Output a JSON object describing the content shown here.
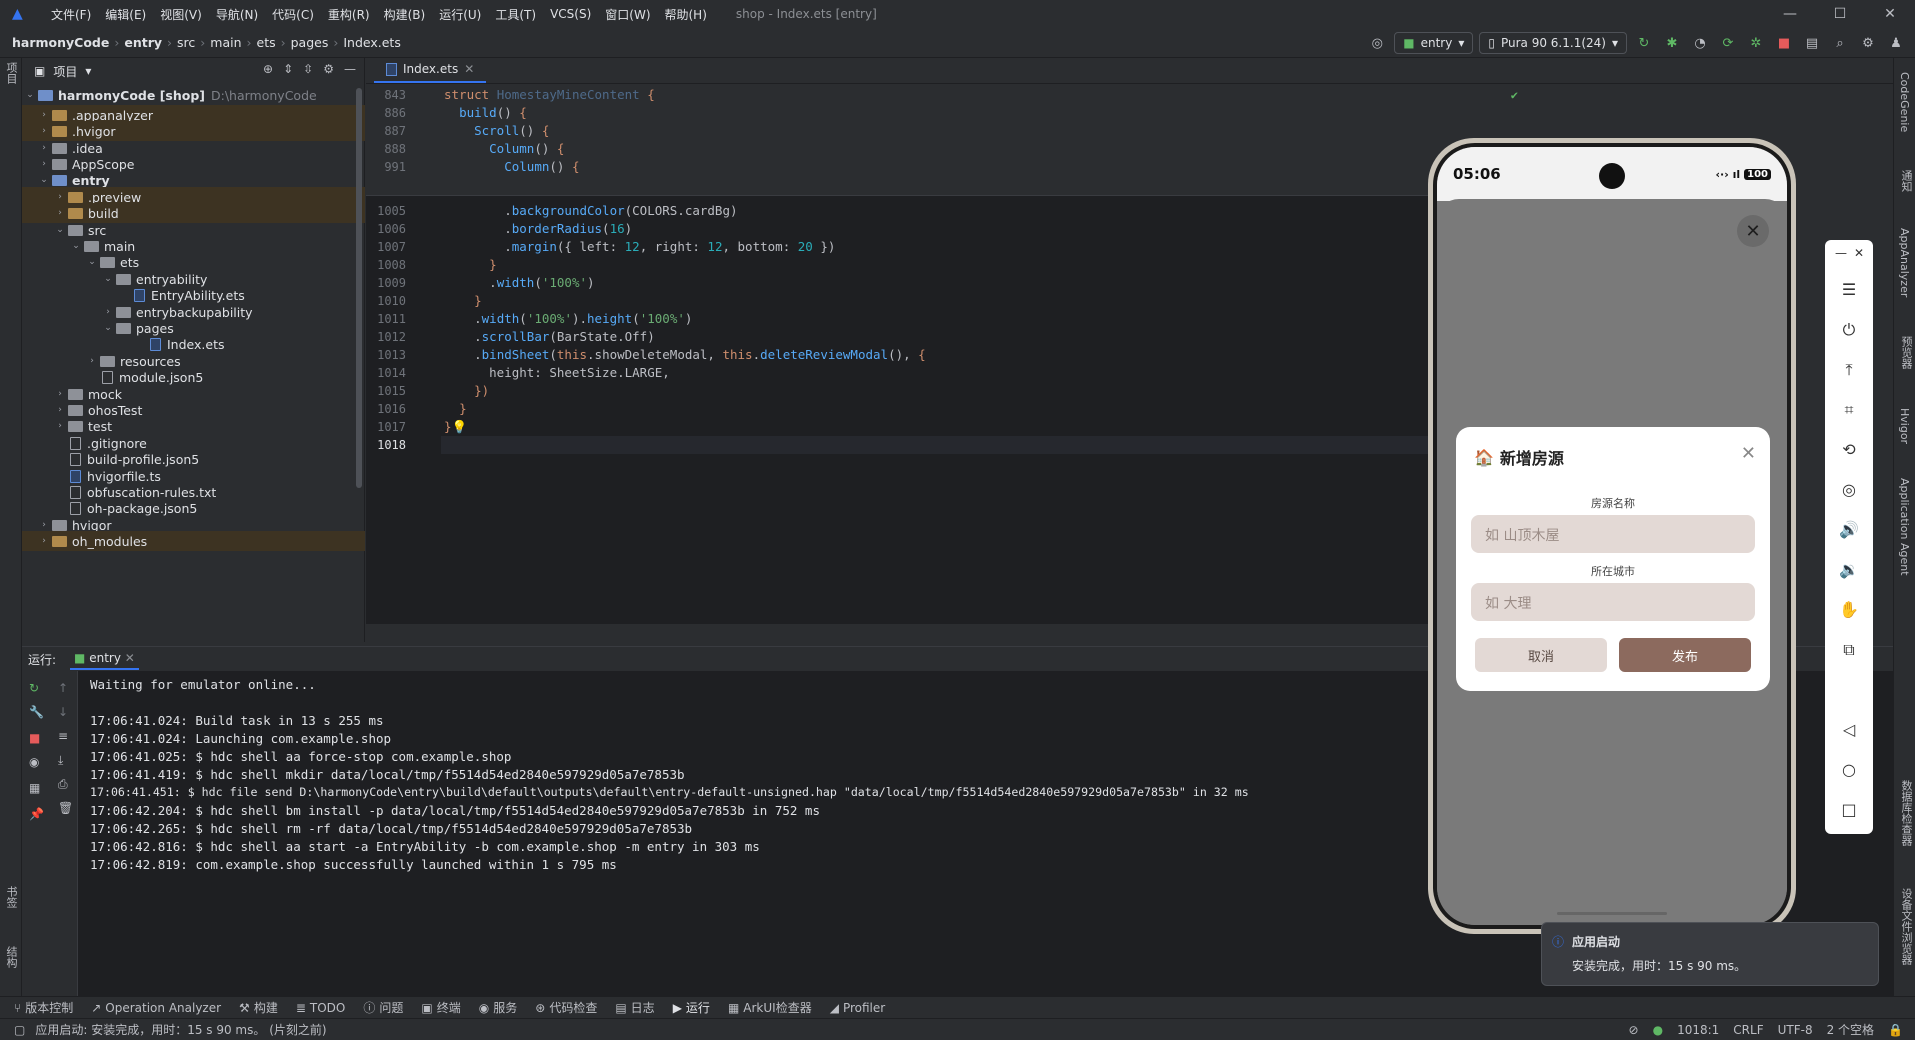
{
  "menubar": {
    "items": [
      "文件(F)",
      "编辑(E)",
      "视图(V)",
      "导航(N)",
      "代码(C)",
      "重构(R)",
      "构建(B)",
      "运行(U)",
      "工具(T)",
      "VCS(S)",
      "窗口(W)",
      "帮助(H)"
    ],
    "title": "shop - Index.ets [entry]"
  },
  "breadcrumb": [
    "harmonyCode",
    "entry",
    "src",
    "main",
    "ets",
    "pages",
    "Index.ets"
  ],
  "toolbar": {
    "run_config": "entry",
    "device": "Pura 90 6.1.1(24)"
  },
  "project": {
    "label": "项目",
    "root_name": "harmonyCode [shop]",
    "root_path": "D:\\harmonyCode",
    "items": [
      ".appanalyzer",
      ".hvigor",
      ".idea",
      "AppScope",
      "entry",
      ".preview",
      "build",
      "src",
      "main",
      "ets",
      "entryability",
      "EntryAbility.ets",
      "entrybackupability",
      "pages",
      "Index.ets",
      "resources",
      "module.json5",
      "mock",
      "ohosTest",
      "test",
      ".gitignore",
      "build-profile.json5",
      "hvigorfile.ts",
      "obfuscation-rules.txt",
      "oh-package.json5",
      "hvigor",
      "oh_modules"
    ]
  },
  "editor": {
    "tab": "Index.ets"
  },
  "run": {
    "label": "运行:",
    "tab": "entry",
    "lines": [
      "Waiting for emulator online...",
      "",
      "17:06:41.024: Build task in 13 s 255 ms",
      "17:06:41.024: Launching com.example.shop",
      "17:06:41.025: $ hdc shell aa force-stop com.example.shop",
      "17:06:41.419: $ hdc shell mkdir data/local/tmp/f5514d54ed2840e597929d05a7e7853b",
      "17:06:41.451: $ hdc file send D:\\harmonyCode\\entry\\build\\default\\outputs\\default\\entry-default-unsigned.hap \"data/local/tmp/f5514d54ed2840e597929d05a7e7853b\" in 32 ms",
      "17:06:42.204: $ hdc shell bm install -p data/local/tmp/f5514d54ed2840e597929d05a7e7853b in 752 ms",
      "17:06:42.265: $ hdc shell rm -rf data/local/tmp/f5514d54ed2840e597929d05a7e7853b",
      "17:06:42.816: $ hdc shell aa start -a EntryAbility -b com.example.shop -m entry in 303 ms",
      "17:06:42.819: com.example.shop successfully launched within 1 s 795 ms"
    ]
  },
  "bottom_tools": [
    "版本控制",
    "Operation Analyzer",
    "构建",
    "TODO",
    "问题",
    "终端",
    "服务",
    "代码检查",
    "日志",
    "运行",
    "ArkUI检查器",
    "Profiler"
  ],
  "status": {
    "message": "应用启动: 安装完成，用时：15 s 90 ms。 (片刻之前)",
    "position": "1018:1",
    "line_sep": "CRLF",
    "encoding": "UTF-8",
    "indent": "2 个空格"
  },
  "right_tools": [
    "CodeGenie",
    "通知",
    "AppAnalyzer",
    "预览器",
    "Hvigor",
    "Application Agent",
    "数据库检查器",
    "设备文件浏览器"
  ],
  "left_tools": [
    "项目",
    "书签",
    "结构"
  ],
  "phone": {
    "time": "05:06",
    "battery": "100"
  },
  "dialog": {
    "title": "新增房源",
    "field1_label": "房源名称",
    "field1_placeholder": "如 山顶木屋",
    "field2_label": "所在城市",
    "field2_placeholder": "如 大理",
    "cancel": "取消",
    "publish": "发布"
  },
  "toast": {
    "title": "应用启动",
    "body": "安装完成，用时：15 s 90 ms。"
  }
}
